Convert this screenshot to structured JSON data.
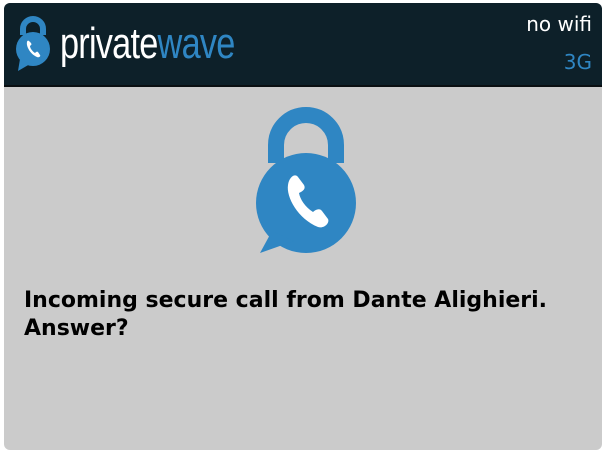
{
  "header": {
    "brand_part1": "private",
    "brand_part2": "wave",
    "wifi_status": "no wifi",
    "network_type": "3G"
  },
  "dialog": {
    "message": "Incoming secure call from Dante Alighieri. Answer?",
    "icon": "secure-call-lock-icon"
  },
  "colors": {
    "header_bg": "#0d2029",
    "accent_blue": "#2f86c3",
    "body_bg": "#cbcbcb"
  }
}
